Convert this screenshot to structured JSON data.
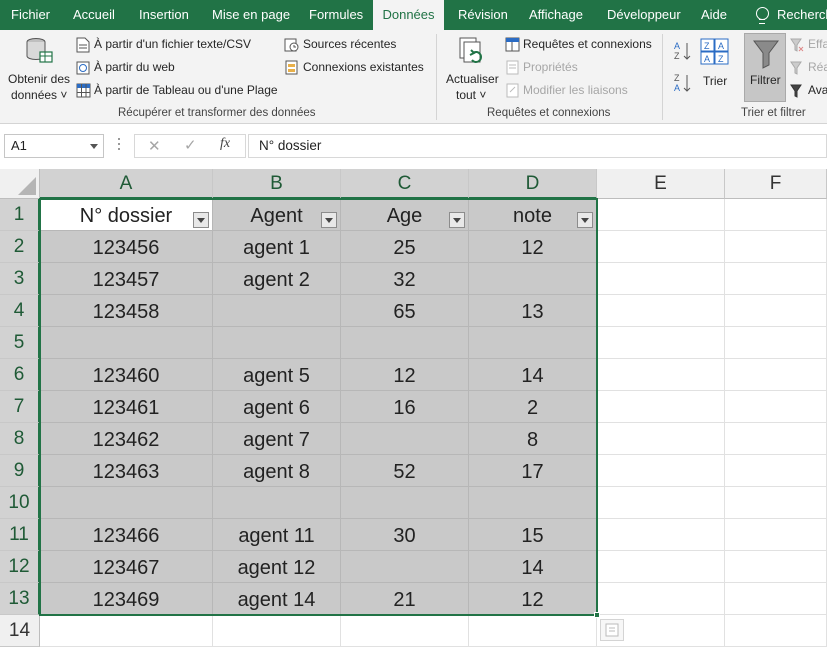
{
  "tabs": [
    "Fichier",
    "Accueil",
    "Insertion",
    "Mise en page",
    "Formules",
    "Données",
    "Révision",
    "Affichage",
    "Développeur",
    "Aide",
    "Recherch"
  ],
  "ribbon": {
    "get_data": {
      "line1": "Obtenir des",
      "line2": "données ˅"
    },
    "from_text": "À partir d'un fichier texte/CSV",
    "from_web": "À partir du web",
    "from_table": "À partir de Tableau ou d'une Plage",
    "recent_sources": "Sources récentes",
    "existing_connections": "Connexions existantes",
    "group_get_transform": "Récupérer et transformer des données",
    "refresh_all": {
      "line1": "Actualiser",
      "line2": "tout ˅"
    },
    "queries_connections": "Requêtes et connexions",
    "properties": "Propriétés",
    "edit_links": "Modifier les liaisons",
    "group_queries": "Requêtes et connexions",
    "sort": "Trier",
    "filter": "Filtrer",
    "clear": "Effa",
    "reapply": "Réa",
    "advanced": "Ava",
    "group_sort_filter": "Trier et filtrer",
    "sort_az_icon": "sort-a-z-icon",
    "sort_za_icon": "sort-z-a-icon",
    "filter_icon": "funnel-icon"
  },
  "formula_bar": {
    "name_box": "A1",
    "cancel_icon": "✕",
    "enter_icon": "✓",
    "fx_label": "fx",
    "content": "N° dossier"
  },
  "columns": [
    "A",
    "B",
    "C",
    "D",
    "E",
    "F"
  ],
  "row_numbers": [
    "1",
    "2",
    "3",
    "4",
    "5",
    "6",
    "7",
    "8",
    "9",
    "10",
    "11",
    "12",
    "13",
    "14"
  ],
  "table": {
    "headers": [
      "N° dossier",
      "Agent",
      "Age",
      "note"
    ],
    "rows": [
      [
        "123456",
        "agent 1",
        "25",
        "12"
      ],
      [
        "123457",
        "agent 2",
        "32",
        ""
      ],
      [
        "123458",
        "",
        "65",
        "13"
      ],
      [
        "",
        "",
        "",
        ""
      ],
      [
        "123460",
        "agent 5",
        "12",
        "14"
      ],
      [
        "123461",
        "agent 6",
        "16",
        "2"
      ],
      [
        "123462",
        "agent 7",
        "",
        "8"
      ],
      [
        "123463",
        "agent 8",
        "52",
        "17"
      ],
      [
        "",
        "",
        "",
        ""
      ],
      [
        "123466",
        "agent 11",
        "30",
        "15"
      ],
      [
        "123467",
        "agent 12",
        "",
        "14"
      ],
      [
        "123469",
        "agent 14",
        "21",
        "12"
      ]
    ]
  },
  "colors": {
    "accent": "#217346",
    "selection_fill": "#c9c9c9"
  }
}
